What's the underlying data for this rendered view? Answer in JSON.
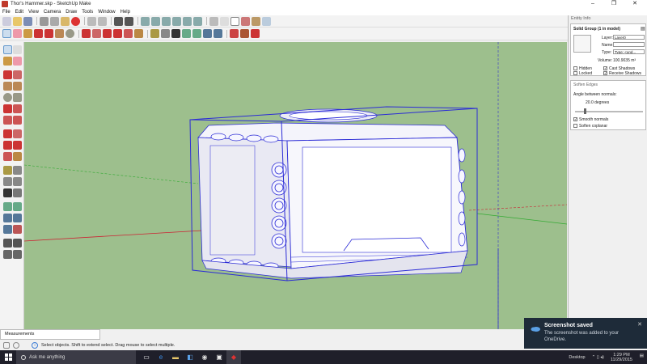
{
  "window": {
    "title": "Thor's Hammer.skp - SketchUp Make",
    "minimize": "–",
    "maximize": "❐",
    "close": "✕"
  },
  "menu": [
    "File",
    "Edit",
    "View",
    "Camera",
    "Draw",
    "Tools",
    "Window",
    "Help"
  ],
  "panel": {
    "entity_info_title": "Entity Info",
    "entity_name": "Solid Group (1 in model)",
    "layer_label": "Layer:",
    "layer_value": "Layer0",
    "name_label": "Name:",
    "type_label": "Type:",
    "type_value": "Type: <und...",
    "volume_label": "Volume:",
    "volume_value": "100.9035 m³",
    "hidden_label": "Hidden",
    "locked_label": "Locked",
    "cast_shadows_label": "Cast Shadows",
    "receive_shadows_label": "Receive Shadows",
    "hidden": false,
    "locked": false,
    "cast_shadows": true,
    "receive_shadows": true,
    "soften_title": "Soften Edges",
    "angle_label": "Angle between normals:",
    "angle_value": "20.0  degrees",
    "smooth_normals_label": "Smooth normals",
    "soften_coplanar_label": "Soften coplanar",
    "smooth_normals": true,
    "soften_coplanar": false
  },
  "measurements_label": "Measurements",
  "status_text": "Select objects. Shift to extend select. Drag mouse to select multiple.",
  "taskbar": {
    "search_placeholder": "Ask me anything",
    "desktop_label": "Desktop",
    "time": "1:29 PM",
    "date": "11/29/2015"
  },
  "toast": {
    "title": "Screenshot saved",
    "body": "The screenshot was added to your OneDrive.",
    "close": "✕"
  },
  "colors": {
    "viewport_ground": "#9dbf8d",
    "selection_blue": "#2b2bd6",
    "taskbar": "#1f1f2a",
    "toast": "#1e2b39"
  }
}
